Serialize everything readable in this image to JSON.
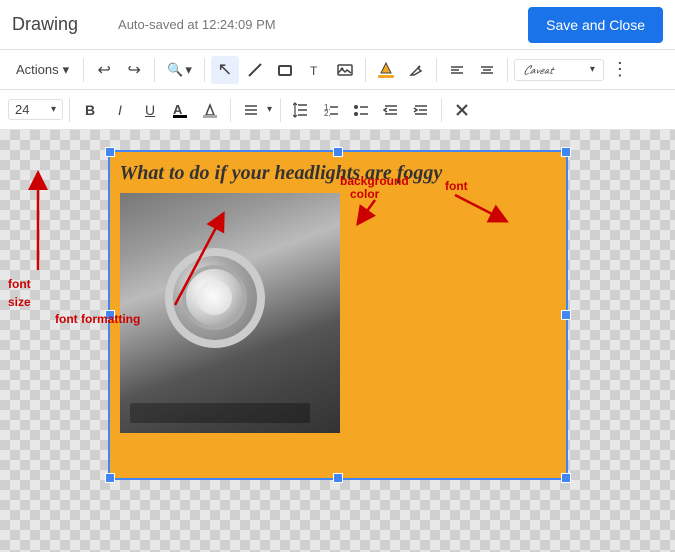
{
  "header": {
    "title": "Drawing",
    "autosave": "Auto-saved at 12:24:09 PM",
    "save_close_label": "Save and Close"
  },
  "toolbar1": {
    "actions_label": "Actions",
    "actions_chevron": "▾",
    "undo_label": "↩",
    "redo_label": "↪",
    "zoom_label": "🔍",
    "zoom_chevron": "▾",
    "select_icon": "↖",
    "line_icon": "╱",
    "shape_icon": "⬜",
    "text_icon": "T",
    "image_icon": "🖼",
    "background_color_icon": "🪣",
    "paint_icon": "🖌",
    "align_left_icon": "≡",
    "align_center_icon": "≡",
    "font_name": "Caveat",
    "font_chevron": "▾",
    "more_icon": "⋮"
  },
  "toolbar2": {
    "font_size": "24",
    "font_size_chevron": "▾",
    "bold_label": "B",
    "italic_label": "I",
    "underline_label": "U",
    "font_color_icon": "A",
    "highlight_icon": "✏",
    "align_icon": "≡",
    "align_chevron": "▾",
    "line_spacing_icon": "↕",
    "ordered_list_icon": "1.",
    "unordered_list_icon": "•",
    "indent_icon": "→|",
    "outdent_icon": "|←",
    "clear_format_icon": "✕"
  },
  "canvas": {
    "drawing_title": "What to do if your headlights are foggy"
  },
  "annotations": {
    "font_size_label": "font\nsize",
    "font_formatting_label": "font formatting",
    "background_color_label": "background\ncolor",
    "font_label": "font"
  }
}
